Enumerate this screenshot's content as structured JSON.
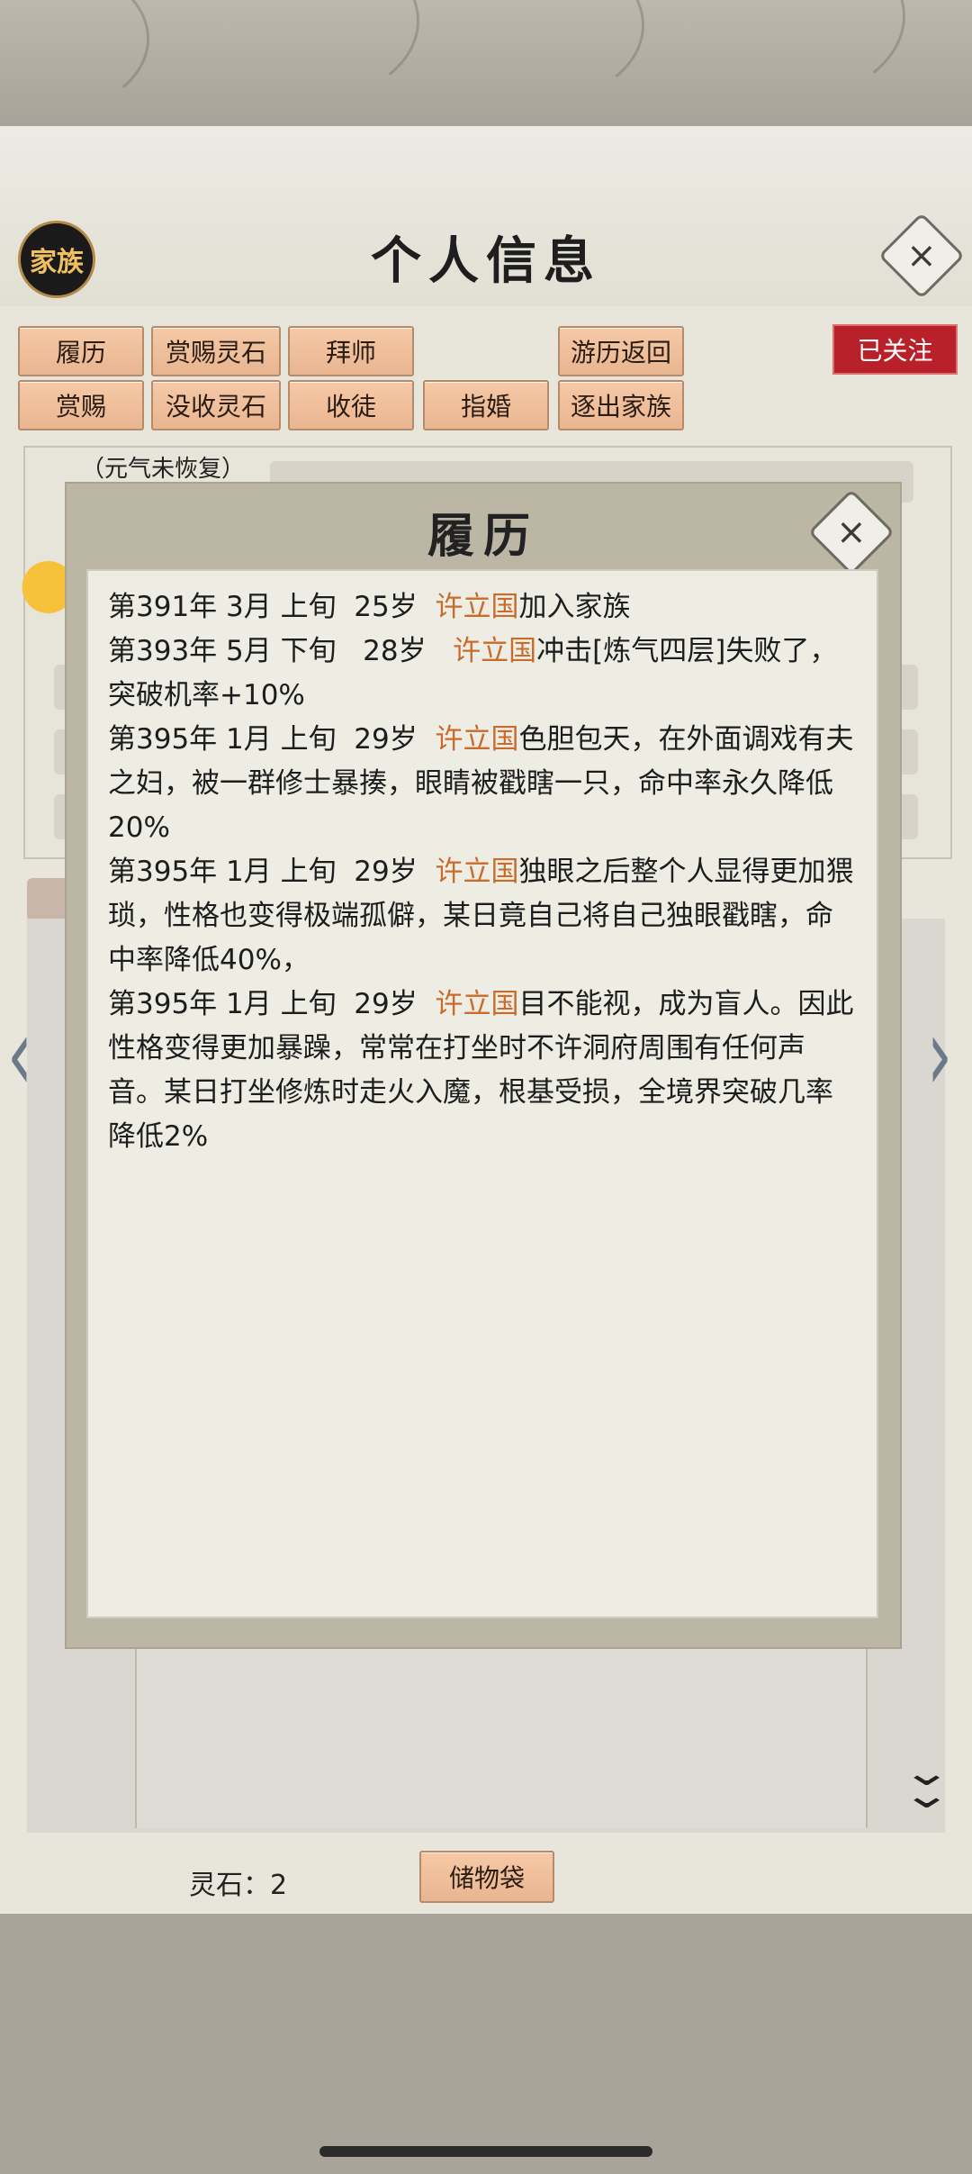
{
  "header": {
    "family_badge": "家族",
    "title": "个人信息",
    "close_icon": "×"
  },
  "actions": {
    "row1": [
      "履历",
      "赏赐灵石",
      "拜师",
      "游历返回"
    ],
    "row2": [
      "赏赐",
      "没收灵石",
      "收徒",
      "指婚",
      "逐出家族"
    ],
    "follow": "已关注"
  },
  "status": {
    "vitality": "（元气未恢复）"
  },
  "footer": {
    "spirit_stones": "灵石：2",
    "bag_button": "储物袋"
  },
  "modal": {
    "title": "履历",
    "close_icon": "×",
    "entries": [
      {
        "date": "第391年 3月 上旬  25岁  ",
        "name": "许立国",
        "text": "加入家族"
      },
      {
        "date": "第393年 5月 下旬   28岁   ",
        "name": "许立国",
        "text": "冲击[炼气四层]失败了，突破机率+10%"
      },
      {
        "date": "第395年 1月 上旬  29岁  ",
        "name": "许立国",
        "text": "色胆包天，在外面调戏有夫之妇，被一群修士暴揍，眼睛被戳瞎一只，命中率永久降低20%"
      },
      {
        "date": "第395年 1月 上旬  29岁  ",
        "name": "许立国",
        "text": "独眼之后整个人显得更加猥琐，性格也变得极端孤僻，某日竟自己将自己独眼戳瞎，命中率降低40%，"
      },
      {
        "date": "第395年 1月 上旬  29岁  ",
        "name": "许立国",
        "text": "目不能视，成为盲人。因此性格变得更加暴躁，常常在打坐时不许洞府周围有任何声音。某日打坐修炼时走火入魔，根基受损，全境界突破几率降低2%"
      }
    ]
  },
  "colors": {
    "name_highlight": "#c96b2c",
    "follow_bg": "#b8202a",
    "button_bg": "#f0c09c"
  }
}
